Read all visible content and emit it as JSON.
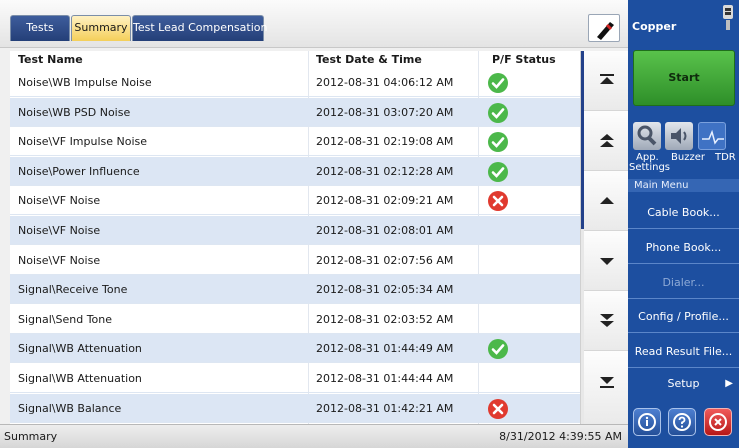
{
  "tabs": [
    {
      "label": "Tests",
      "active": false
    },
    {
      "label": "Summary",
      "active": true
    },
    {
      "label": "Test Lead Compensation",
      "active": false
    }
  ],
  "table": {
    "headers": {
      "name": "Test Name",
      "date": "Test Date & Time",
      "status": "P/F Status"
    },
    "rows": [
      {
        "name": "Noise\\WB Impulse Noise",
        "date": "2012-08-31 04:06:12 AM",
        "status": "pass"
      },
      {
        "name": "Noise\\WB PSD Noise",
        "date": "2012-08-31 03:07:20 AM",
        "status": "pass"
      },
      {
        "name": "Noise\\VF Impulse Noise",
        "date": "2012-08-31 02:19:08 AM",
        "status": "pass"
      },
      {
        "name": "Noise\\Power Influence",
        "date": "2012-08-31 02:12:28 AM",
        "status": "pass"
      },
      {
        "name": "Noise\\VF Noise",
        "date": "2012-08-31 02:09:21 AM",
        "status": "fail"
      },
      {
        "name": "Noise\\VF Noise",
        "date": "2012-08-31 02:08:01 AM",
        "status": ""
      },
      {
        "name": "Noise\\VF Noise",
        "date": "2012-08-31 02:07:56 AM",
        "status": ""
      },
      {
        "name": "Signal\\Receive Tone",
        "date": "2012-08-31 02:05:34 AM",
        "status": ""
      },
      {
        "name": "Signal\\Send Tone",
        "date": "2012-08-31 02:03:52 AM",
        "status": ""
      },
      {
        "name": "Signal\\WB Attenuation",
        "date": "2012-08-31 01:44:49 AM",
        "status": "pass"
      },
      {
        "name": "Signal\\WB Attenuation",
        "date": "2012-08-31 01:44:44 AM",
        "status": ""
      },
      {
        "name": "Signal\\WB Balance",
        "date": "2012-08-31 01:42:21 AM",
        "status": "fail"
      }
    ]
  },
  "statusbar": {
    "left": "Summary",
    "right": "8/31/2012 4:39:55 AM"
  },
  "sidebar": {
    "title": "Copper",
    "start_label": "Start",
    "tools": {
      "app_line1": "App.",
      "app_line2": "Settings",
      "buzzer": "Buzzer",
      "tdr": "TDR"
    },
    "menu_header": "Main Menu",
    "menu": [
      {
        "label": "Cable Book...",
        "enabled": true
      },
      {
        "label": "Phone Book...",
        "enabled": true
      },
      {
        "label": "Dialer...",
        "enabled": false
      },
      {
        "label": "Config / Profile...",
        "enabled": true
      },
      {
        "label": "Read Result File...",
        "enabled": true
      },
      {
        "label": "Setup",
        "enabled": true
      }
    ],
    "setup_arrow": "▶"
  },
  "colors": {
    "pass": "#4cb84a",
    "fail": "#e03a2f",
    "accent": "#1d4fa0",
    "row_alt": "#dce6f4"
  }
}
